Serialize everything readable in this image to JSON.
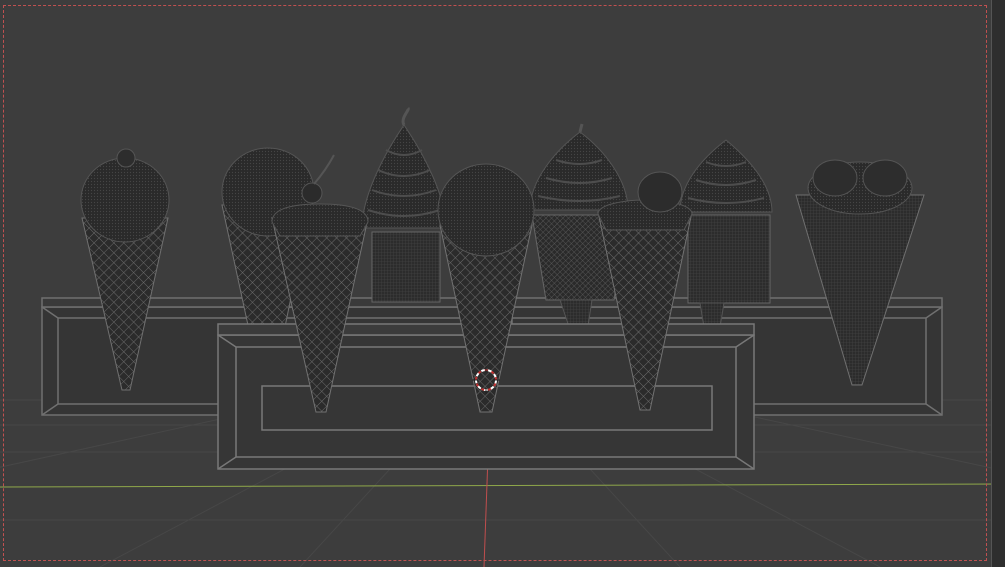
{
  "viewport": {
    "background": "#3d3d3d",
    "shading": "wireframe",
    "camera_frame_color": "#c05050",
    "axis_x_color": "#8fa84a",
    "axis_y_color": "#c04e4e",
    "cursor_icon": "3d-cursor-icon"
  },
  "scene_objects": [
    {
      "name": "cone-scoop-1",
      "topping": "scoop-with-bead"
    },
    {
      "name": "cone-scoop-2",
      "topping": "scoop"
    },
    {
      "name": "cone-cherry",
      "topping": "cherry"
    },
    {
      "name": "cup-swirl-tall",
      "topping": "soft-serve-swirl"
    },
    {
      "name": "cone-scoop-center",
      "topping": "scoop"
    },
    {
      "name": "cup-swirl-center",
      "topping": "soft-serve-swirl"
    },
    {
      "name": "cone-sprinkles",
      "topping": "sprinkles"
    },
    {
      "name": "cup-swirl-right",
      "topping": "soft-serve-swirl"
    },
    {
      "name": "cone-double-scoop",
      "topping": "double-scoop"
    },
    {
      "name": "rack-back",
      "topping": ""
    },
    {
      "name": "rack-front",
      "topping": ""
    }
  ]
}
